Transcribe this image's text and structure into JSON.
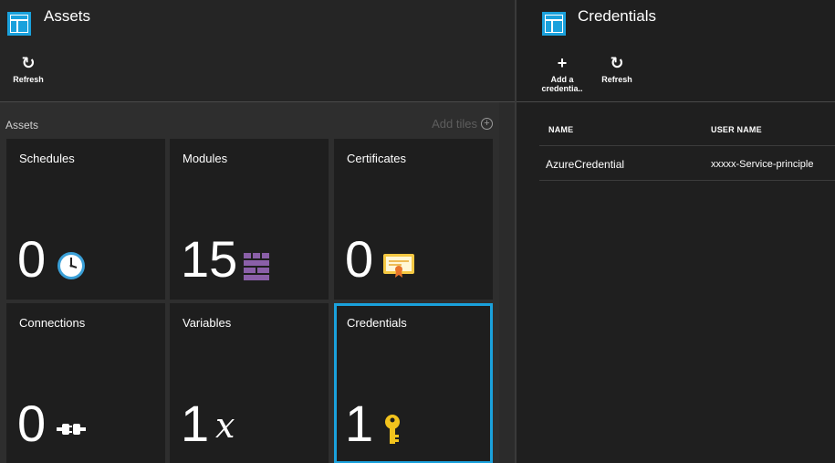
{
  "assets_blade": {
    "title": "Assets",
    "commands": [
      {
        "label": "Refresh",
        "icon": "refresh-icon"
      }
    ],
    "lens_title": "Assets",
    "add_tiles": "Add tiles",
    "tiles": [
      {
        "name": "Schedules",
        "count": "0",
        "icon": "clock-icon"
      },
      {
        "name": "Modules",
        "count": "15",
        "icon": "modules-icon"
      },
      {
        "name": "Certificates",
        "count": "0",
        "icon": "certificate-icon"
      },
      {
        "name": "Connections",
        "count": "0",
        "icon": "connection-plug-icon"
      },
      {
        "name": "Variables",
        "count": "1",
        "icon": "variable-x-icon",
        "glyph": "x"
      },
      {
        "name": "Credentials",
        "count": "1",
        "icon": "key-icon",
        "selected": true
      }
    ]
  },
  "credentials_blade": {
    "title": "Credentials",
    "commands": [
      {
        "label_line1": "Add a",
        "label_line2": "credentia..",
        "icon": "plus-icon"
      },
      {
        "label": "Refresh",
        "icon": "refresh-icon"
      }
    ],
    "columns": [
      "NAME",
      "USER NAME"
    ],
    "rows": [
      {
        "name": "AzureCredential",
        "user_name": "xxxxx-Service-principle"
      }
    ]
  },
  "colors": {
    "accent_selected": "#1aa1dc",
    "blade_icon": "#1aa1dc",
    "modules_icon": "#8a5fa8",
    "key_icon": "#f2c31d",
    "certificate_icon": "#f5c842"
  }
}
